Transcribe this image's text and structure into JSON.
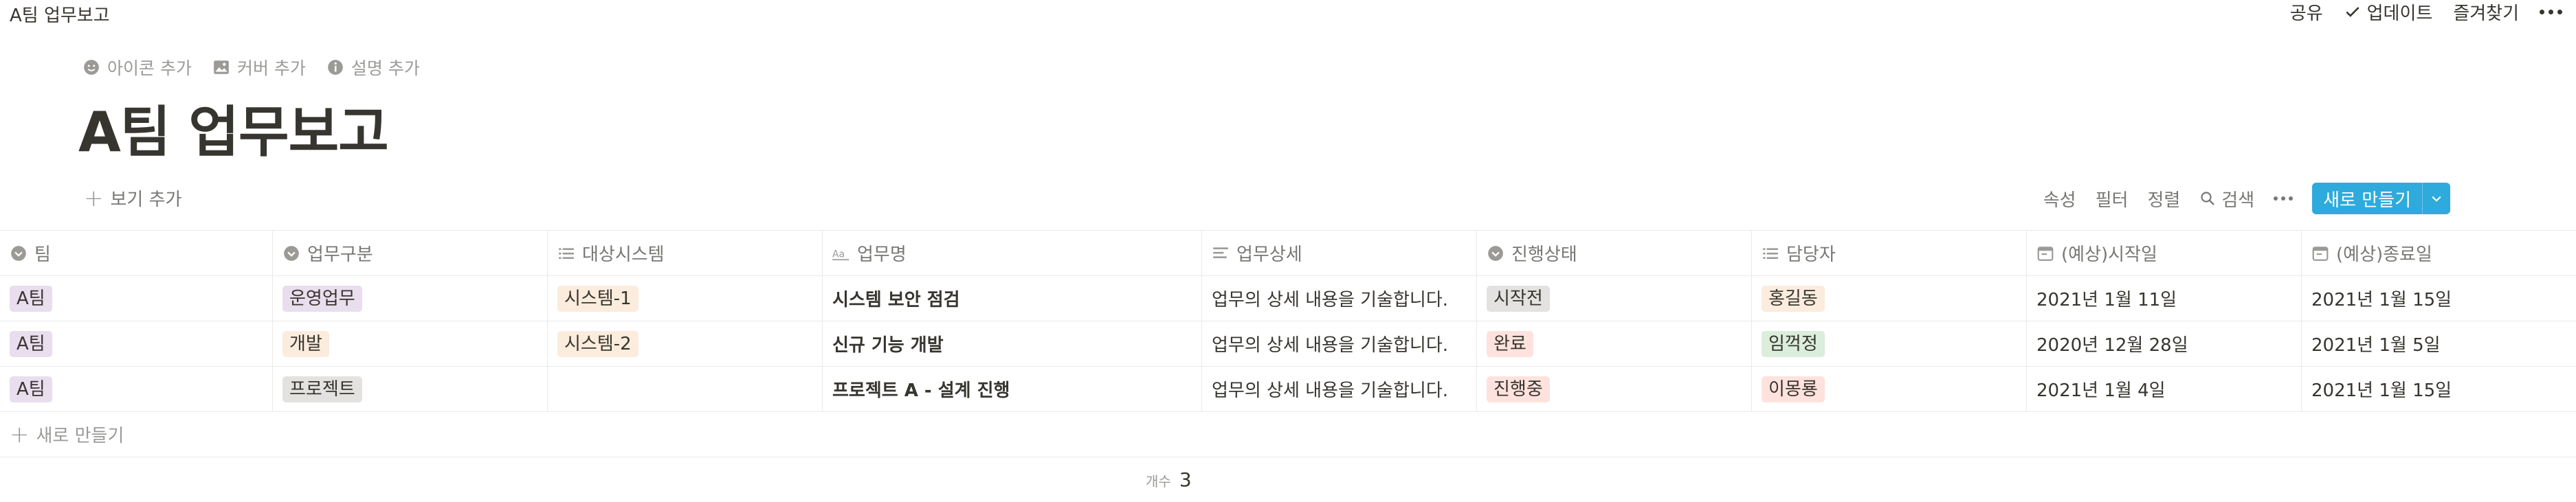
{
  "topbar": {
    "title": "A팀 업무보고",
    "share": "공유",
    "update": "업데이트",
    "favorite": "즐겨찾기"
  },
  "page": {
    "actions": {
      "add_icon": "아이콘 추가",
      "add_cover": "커버 추가",
      "add_desc": "설명 추가"
    },
    "title": "A팀 업무보고"
  },
  "view": {
    "add_view": "보기 추가",
    "properties": "속성",
    "filter": "필터",
    "sort": "정렬",
    "search": "검색",
    "new_button": "새로 만들기"
  },
  "table": {
    "columns": [
      "팀",
      "업무구분",
      "대상시스템",
      "업무명",
      "업무상세",
      "진행상태",
      "담당자",
      "(예상)시작일",
      "(예상)종료일"
    ],
    "rows": [
      {
        "team": "A팀",
        "category": "운영업무",
        "system": "시스템-1",
        "name": "시스템 보안 점검",
        "detail": "업무의 상세 내용을 기술합니다.",
        "status": "시작전",
        "owner": "홍길동",
        "start": "2021년 1월 11일",
        "end": "2021년 1월 15일"
      },
      {
        "team": "A팀",
        "category": "개발",
        "system": "시스템-2",
        "name": "신규 기능 개발",
        "detail": "업무의 상세 내용을 기술합니다.",
        "status": "완료",
        "owner": "임꺽정",
        "start": "2020년 12월 28일",
        "end": "2021년 1월 5일"
      },
      {
        "team": "A팀",
        "category": "프로젝트",
        "system": "",
        "name": "프로젝트 A - 설계 진행",
        "detail": "업무의 상세 내용을 기술합니다.",
        "status": "진행중",
        "owner": "이몽룡",
        "start": "2021년 1월 4일",
        "end": "2021년 1월 15일"
      }
    ],
    "new_row": "새로 만들기",
    "count_label": "개수",
    "count_value": "3"
  },
  "colors": {
    "accent": "#2eaadc",
    "tag_purple": "#e8deee",
    "tag_yellow": "#fbecdd",
    "tag_gray": "#e3e2e0",
    "tag_red": "#ffe2dd",
    "tag_green": "#dbeddb"
  }
}
